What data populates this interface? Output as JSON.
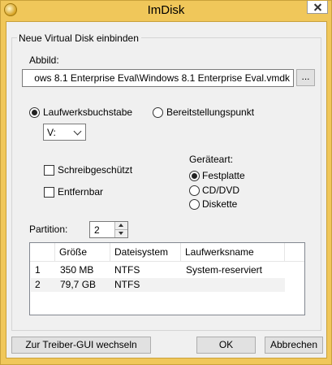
{
  "window": {
    "title": "ImDisk"
  },
  "group": {
    "title": "Neue Virtual Disk einbinden"
  },
  "image": {
    "label": "Abbild:",
    "path": "ows 8.1 Enterprise Eval\\Windows 8.1 Enterprise Eval.vmdk",
    "browse_label": "..."
  },
  "mount": {
    "drive_letter_label": "Laufwerksbuchstabe",
    "mount_point_label": "Bereitstellungspunkt",
    "drive_letter_value": "V:"
  },
  "options": {
    "readonly_label": "Schreibgeschützt",
    "removable_label": "Entfernbar"
  },
  "device_type": {
    "label": "Geräteart:",
    "options": [
      "Festplatte",
      "CD/DVD",
      "Diskette"
    ],
    "selected": "Festplatte"
  },
  "partition": {
    "label": "Partition:",
    "value": "2"
  },
  "partitions_table": {
    "columns": [
      "Größe",
      "Dateisystem",
      "Laufwerksname"
    ],
    "rows": [
      {
        "index": "1",
        "size": "350 MB",
        "fs": "NTFS",
        "name": "System-reserviert"
      },
      {
        "index": "2",
        "size": "79,7 GB",
        "fs": "NTFS",
        "name": ""
      }
    ]
  },
  "buttons": {
    "driver_gui": "Zur Treiber-GUI wechseln",
    "ok": "OK",
    "cancel": "Abbrechen"
  }
}
